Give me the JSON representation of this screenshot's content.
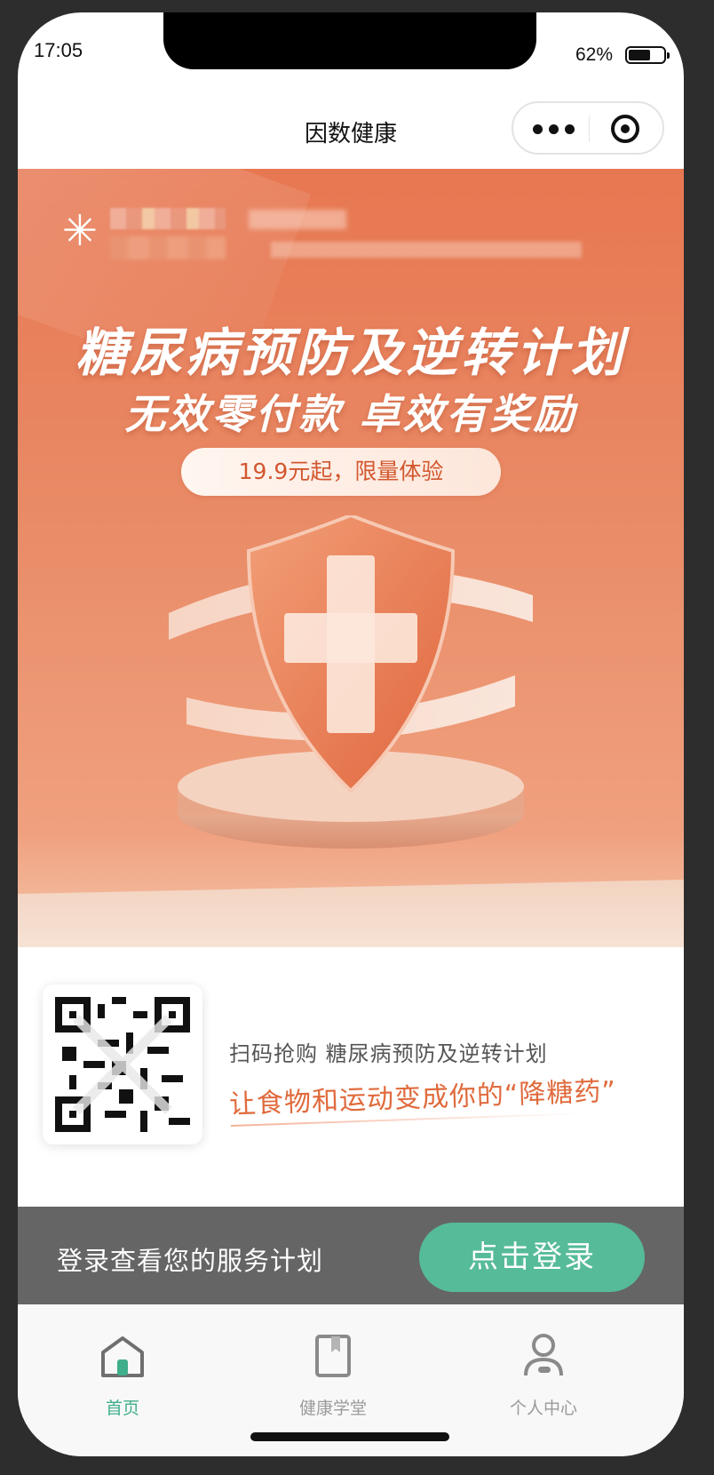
{
  "status_bar": {
    "time": "17:05",
    "battery": "62%",
    "battery_level": 0.62
  },
  "nav": {
    "title": "因数健康",
    "more_icon": "more-dots-icon",
    "close_icon": "target-icon"
  },
  "banner": {
    "headline": "糖尿病预防及逆转计划",
    "subline": "无效零付款  卓效有奖励",
    "price_tag": "19.9元起，限量体验",
    "colors": {
      "top": "#e77751",
      "bottom": "#f5c6ac"
    }
  },
  "promo": {
    "line1": "扫码抢购  糖尿病预防及逆转计划",
    "line2": "让食物和运动变成你的“降糖药”"
  },
  "login_bar": {
    "text": "登录查看您的服务计划",
    "button": "点击登录",
    "button_color": "#56bb99"
  },
  "tabs": [
    {
      "label": "首页",
      "icon": "home-icon",
      "active": true,
      "color": "#3fae8b"
    },
    {
      "label": "健康学堂",
      "icon": "book-icon",
      "active": false,
      "color": "#9a9a9a"
    },
    {
      "label": "个人中心",
      "icon": "person-icon",
      "active": false,
      "color": "#9a9a9a"
    }
  ]
}
